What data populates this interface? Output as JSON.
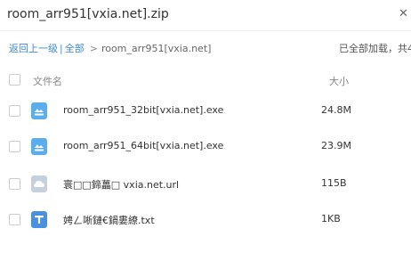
{
  "window": {
    "title": "room_arr951[vxia.net].zip"
  },
  "toolbar": {
    "back_label": "返回上一级",
    "separator": "|",
    "all_label": "全部",
    "arrow": ">",
    "current_folder": "room_arr951[vxia.net]",
    "load_status": "已全部加载，共4个"
  },
  "header": {
    "name_label": "文件名",
    "size_label": "大小"
  },
  "files": [
    {
      "name": "room_arr951_32bit[vxia.net].exe",
      "size": "24.8M",
      "icon": "exe-file-icon",
      "color": "#5aaef0"
    },
    {
      "name": "room_arr951_64bit[vxia.net].exe",
      "size": "23.9M",
      "icon": "exe-file-icon",
      "color": "#5aaef0"
    },
    {
      "name": "寰□□鍗藟□ vxia.net.url",
      "size": "115B",
      "icon": "url-file-icon",
      "color": "#c5d0dc"
    },
    {
      "name": "娉ㄥ唽鏈€鍋婁繚.txt",
      "size": "1KB",
      "icon": "txt-file-icon",
      "color": "#4a90e2"
    }
  ]
}
